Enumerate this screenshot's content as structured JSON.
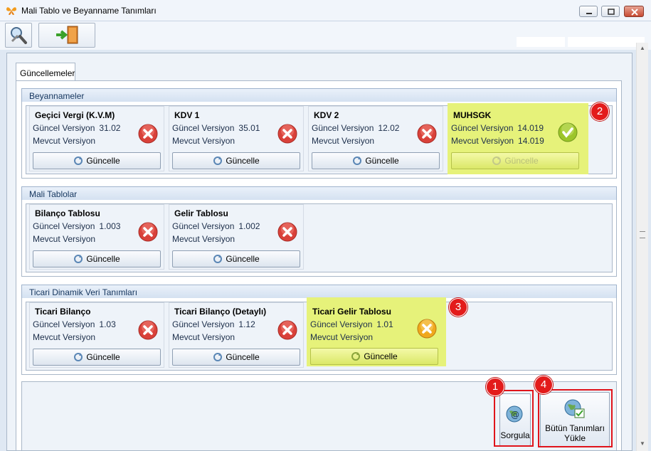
{
  "window": {
    "title": "Mali Tablo ve Beyanname Tanımları"
  },
  "tabs": [
    {
      "label": "Güncellemeler",
      "active": true
    }
  ],
  "labels": {
    "current_version": "Güncel Versiyon",
    "existing_version": "Mevcut Versiyon",
    "update": "Güncelle"
  },
  "sections": [
    {
      "title": "Beyannameler",
      "cards": [
        {
          "title": "Geçici Vergi (K.V.M)",
          "current": "31.02",
          "existing": "",
          "status": "error",
          "highlight": false,
          "update_enabled": true
        },
        {
          "title": "KDV 1",
          "current": "35.01",
          "existing": "",
          "status": "error",
          "highlight": false,
          "update_enabled": true
        },
        {
          "title": "KDV 2",
          "current": "12.02",
          "existing": "",
          "status": "error",
          "highlight": false,
          "update_enabled": true
        },
        {
          "title": "MUHSGK",
          "current": "14.019",
          "existing": "14.019",
          "status": "ok",
          "highlight": true,
          "update_enabled": false
        }
      ]
    },
    {
      "title": "Mali Tablolar",
      "cards": [
        {
          "title": "Bilanço Tablosu",
          "current": "1.003",
          "existing": "",
          "status": "error",
          "highlight": false,
          "update_enabled": true
        },
        {
          "title": "Gelir Tablosu",
          "current": "1.002",
          "existing": "",
          "status": "error",
          "highlight": false,
          "update_enabled": true
        }
      ]
    },
    {
      "title": "Ticari Dinamik Veri Tanımları",
      "cards": [
        {
          "title": "Ticari Bilanço",
          "current": "1.03",
          "existing": "",
          "status": "error",
          "highlight": false,
          "update_enabled": true
        },
        {
          "title": "Ticari Bilanço (Detaylı)",
          "current": "1.12",
          "existing": "",
          "status": "error",
          "highlight": false,
          "update_enabled": true
        },
        {
          "title": "Ticari Gelir Tablosu",
          "current": "1.01",
          "existing": "",
          "status": "warning",
          "highlight": true,
          "update_enabled": true
        }
      ]
    }
  ],
  "actions": {
    "query": "Sorgula",
    "load_all_line1": "Bütün Tanımları",
    "load_all_line2": "Yükle"
  },
  "callouts": [
    "1",
    "2",
    "3",
    "4"
  ],
  "colors": {
    "highlight": "#e6f27a",
    "callout": "#e31b1b",
    "error": "#d9413a",
    "ok": "#9cc52a",
    "warning": "#f0a81c"
  }
}
